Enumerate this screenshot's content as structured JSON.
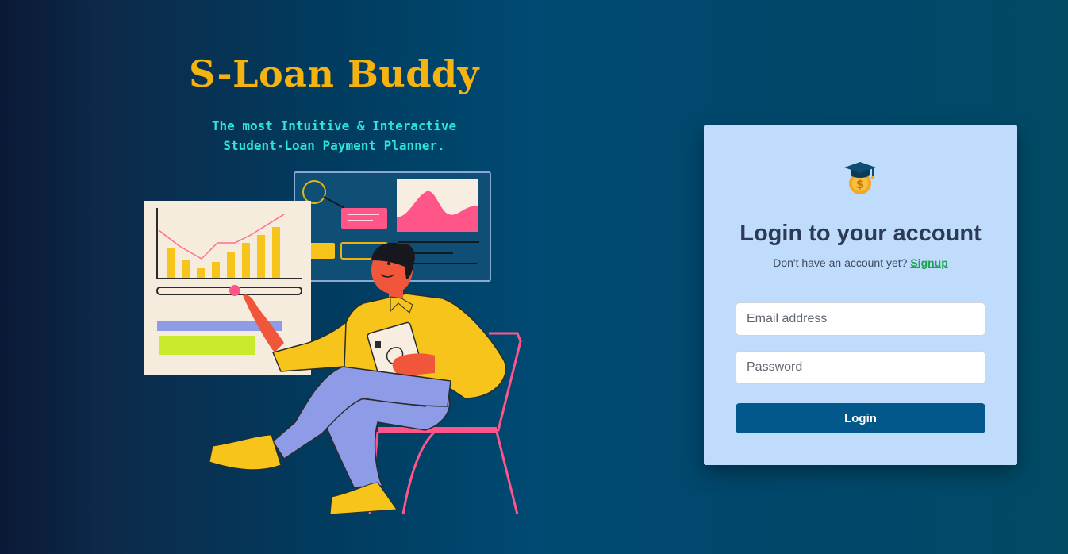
{
  "brand": {
    "title": "S-Loan Buddy",
    "tagline_line1": "The most Intuitive & Interactive",
    "tagline_line2": "Student-Loan Payment Planner."
  },
  "hero": {
    "illustration": "person-with-tablet-and-charts-illustration"
  },
  "login": {
    "logo_icon": "graduation-cap-coin-icon",
    "title": "Login to your account",
    "subtitle_prefix": "Don't have an account yet?",
    "signup_label": "Signup",
    "email_placeholder": "Email address",
    "email_value": "",
    "password_placeholder": "Password",
    "password_value": "",
    "button_label": "Login"
  },
  "colors": {
    "brand_title": "#f4b310",
    "tagline": "#2ee6d8",
    "card_background": "#bfdcfd",
    "button": "#02578b",
    "signup_link": "#1aa34a"
  }
}
